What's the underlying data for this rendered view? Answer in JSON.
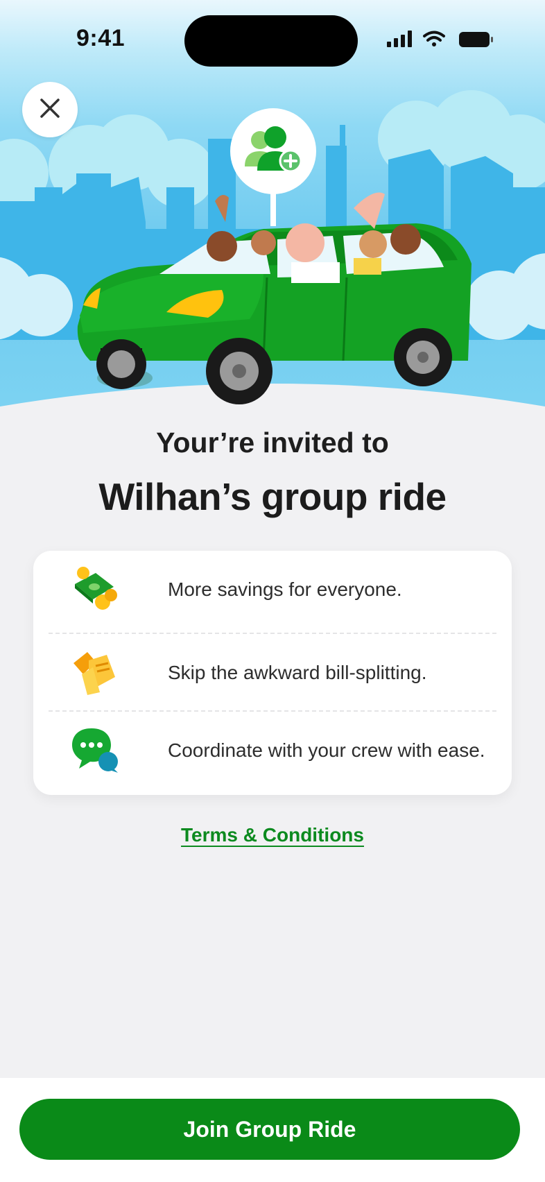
{
  "status_bar": {
    "time": "9:41"
  },
  "header": {
    "close_icon": "close-icon",
    "badge_icon": "group-add-icon"
  },
  "invite": {
    "subtitle": "Your’re invited to",
    "title": "Wilhan’s group ride"
  },
  "benefits": [
    {
      "icon": "money-coins-icon",
      "text": "More savings for everyone."
    },
    {
      "icon": "receipt-split-icon",
      "text": "Skip the awkward bill-splitting."
    },
    {
      "icon": "chat-bubbles-icon",
      "text": "Coordinate with your crew with ease."
    }
  ],
  "terms": {
    "label": "Terms & Conditions"
  },
  "footer": {
    "join_label": "Join Group Ride"
  },
  "colors": {
    "brand_green": "#0a8a18",
    "link_green": "#0c8a1f",
    "sky_blue": "#6cc9ef"
  }
}
